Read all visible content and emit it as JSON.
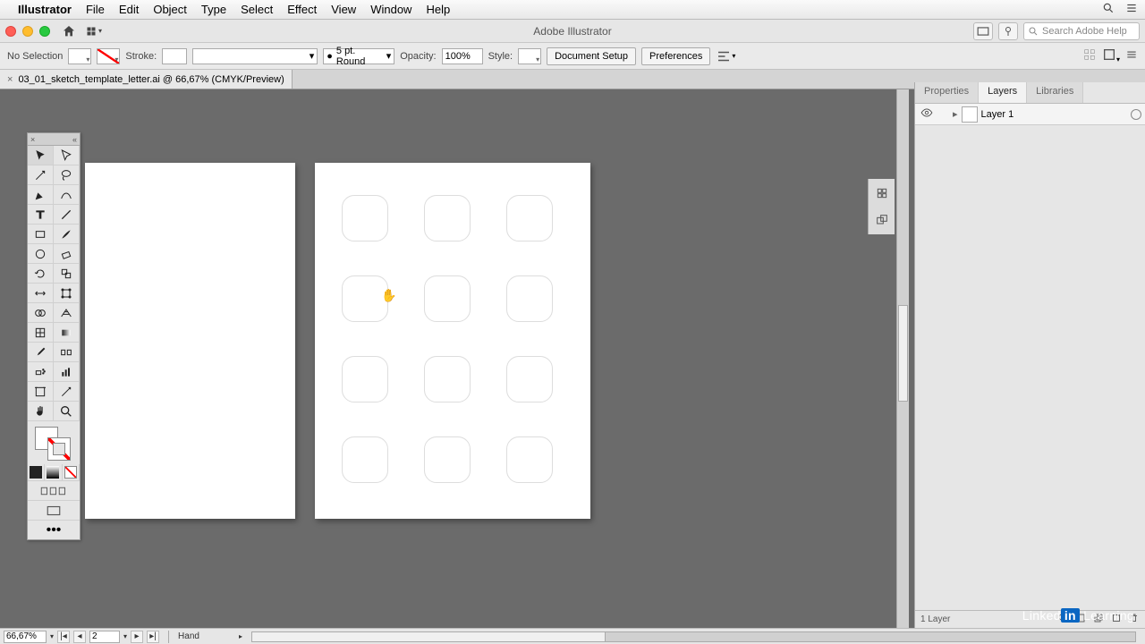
{
  "menubar": {
    "app": "Illustrator",
    "items": [
      "File",
      "Edit",
      "Object",
      "Type",
      "Select",
      "Effect",
      "View",
      "Window",
      "Help"
    ]
  },
  "appbar": {
    "title": "Adobe Illustrator",
    "search_placeholder": "Search Adobe Help"
  },
  "controlbar": {
    "selection_label": "No Selection",
    "stroke_label": "Stroke:",
    "stroke_weight": "",
    "profile_value": "5 pt. Round",
    "opacity_label": "Opacity:",
    "opacity_value": "100%",
    "style_label": "Style:",
    "btn_docsetup": "Document Setup",
    "btn_prefs": "Preferences"
  },
  "document": {
    "tab_title": "03_01_sketch_template_letter.ai @ 66,67% (CMYK/Preview)"
  },
  "panels": {
    "tabs": [
      "Properties",
      "Layers",
      "Libraries"
    ],
    "active_tab": "Layers",
    "layer_name": "Layer 1",
    "footer_count": "1 Layer"
  },
  "statusbar": {
    "zoom": "66,67%",
    "artboard_number": "2",
    "tool": "Hand"
  },
  "branding": {
    "text_a": "Linked",
    "text_b": "in",
    "text_c": " Learning"
  }
}
